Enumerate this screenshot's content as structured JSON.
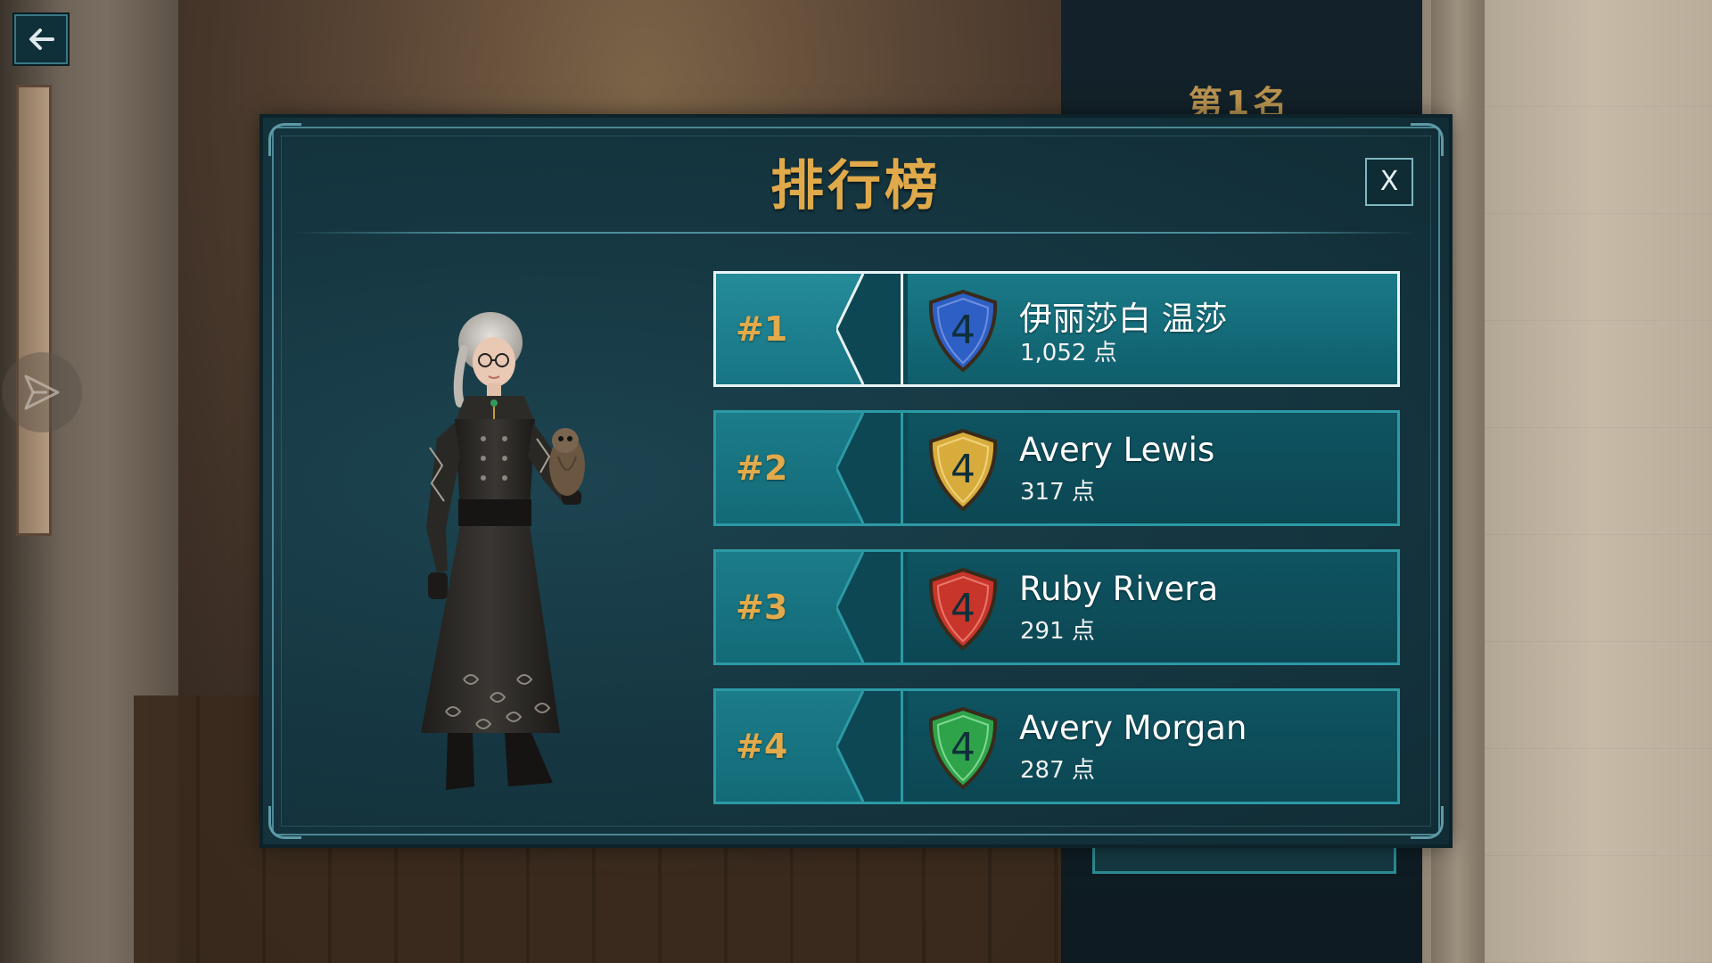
{
  "background": {
    "rank_text": "第1名"
  },
  "navigation": {
    "back_icon": "back-arrow-icon",
    "side_icon": "send-icon"
  },
  "modal": {
    "title": "排行榜",
    "close_label": "X"
  },
  "leaderboard": {
    "entries": [
      {
        "rank": "#1",
        "crest_level": "4",
        "crest_color": "#2e5fc4",
        "name": "伊丽莎白 温莎",
        "points": "1,052 点",
        "selected": true
      },
      {
        "rank": "#2",
        "crest_level": "4",
        "crest_color": "#d8ac3c",
        "name": "Avery Lewis",
        "points": "317 点",
        "selected": false
      },
      {
        "rank": "#3",
        "crest_level": "4",
        "crest_color": "#c8352a",
        "name": "Ruby Rivera",
        "points": "291 点",
        "selected": false
      },
      {
        "rank": "#4",
        "crest_level": "4",
        "crest_color": "#2fa34a",
        "name": "Avery Morgan",
        "points": "287 点",
        "selected": false
      }
    ]
  },
  "colors": {
    "accent_gold": "#e0a94a",
    "row_border": "#2c9aa5",
    "selected_border": "#e8f3f5"
  }
}
